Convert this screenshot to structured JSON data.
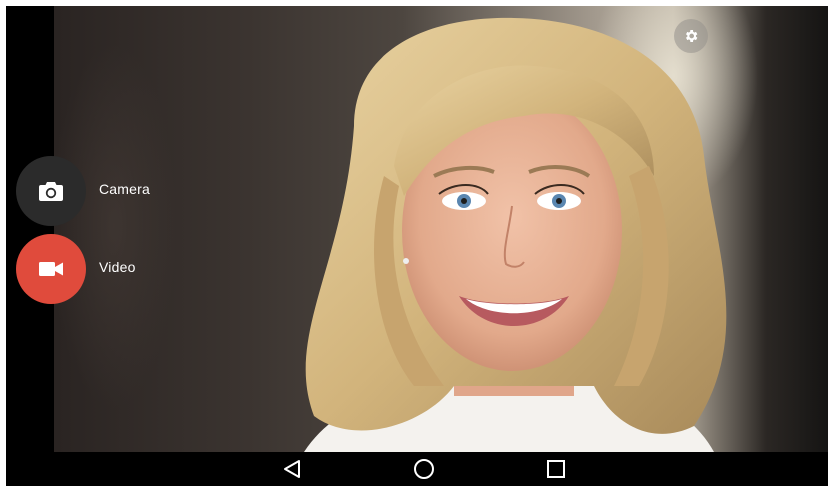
{
  "app": {
    "modes": [
      {
        "label": "Camera",
        "icon": "camera-icon",
        "color": "#2b2b2b"
      },
      {
        "label": "Video",
        "icon": "video-icon",
        "color": "#e04b3c"
      }
    ],
    "settings_icon": "gear-icon"
  },
  "navigation": {
    "back_icon": "back-triangle-icon",
    "home_icon": "home-circle-icon",
    "recents_icon": "recents-square-icon"
  },
  "colors": {
    "camera_button": "#2b2b2b",
    "video_button": "#e04b3c",
    "label_text": "#ffffff",
    "nav_icons": "#ffffff"
  }
}
